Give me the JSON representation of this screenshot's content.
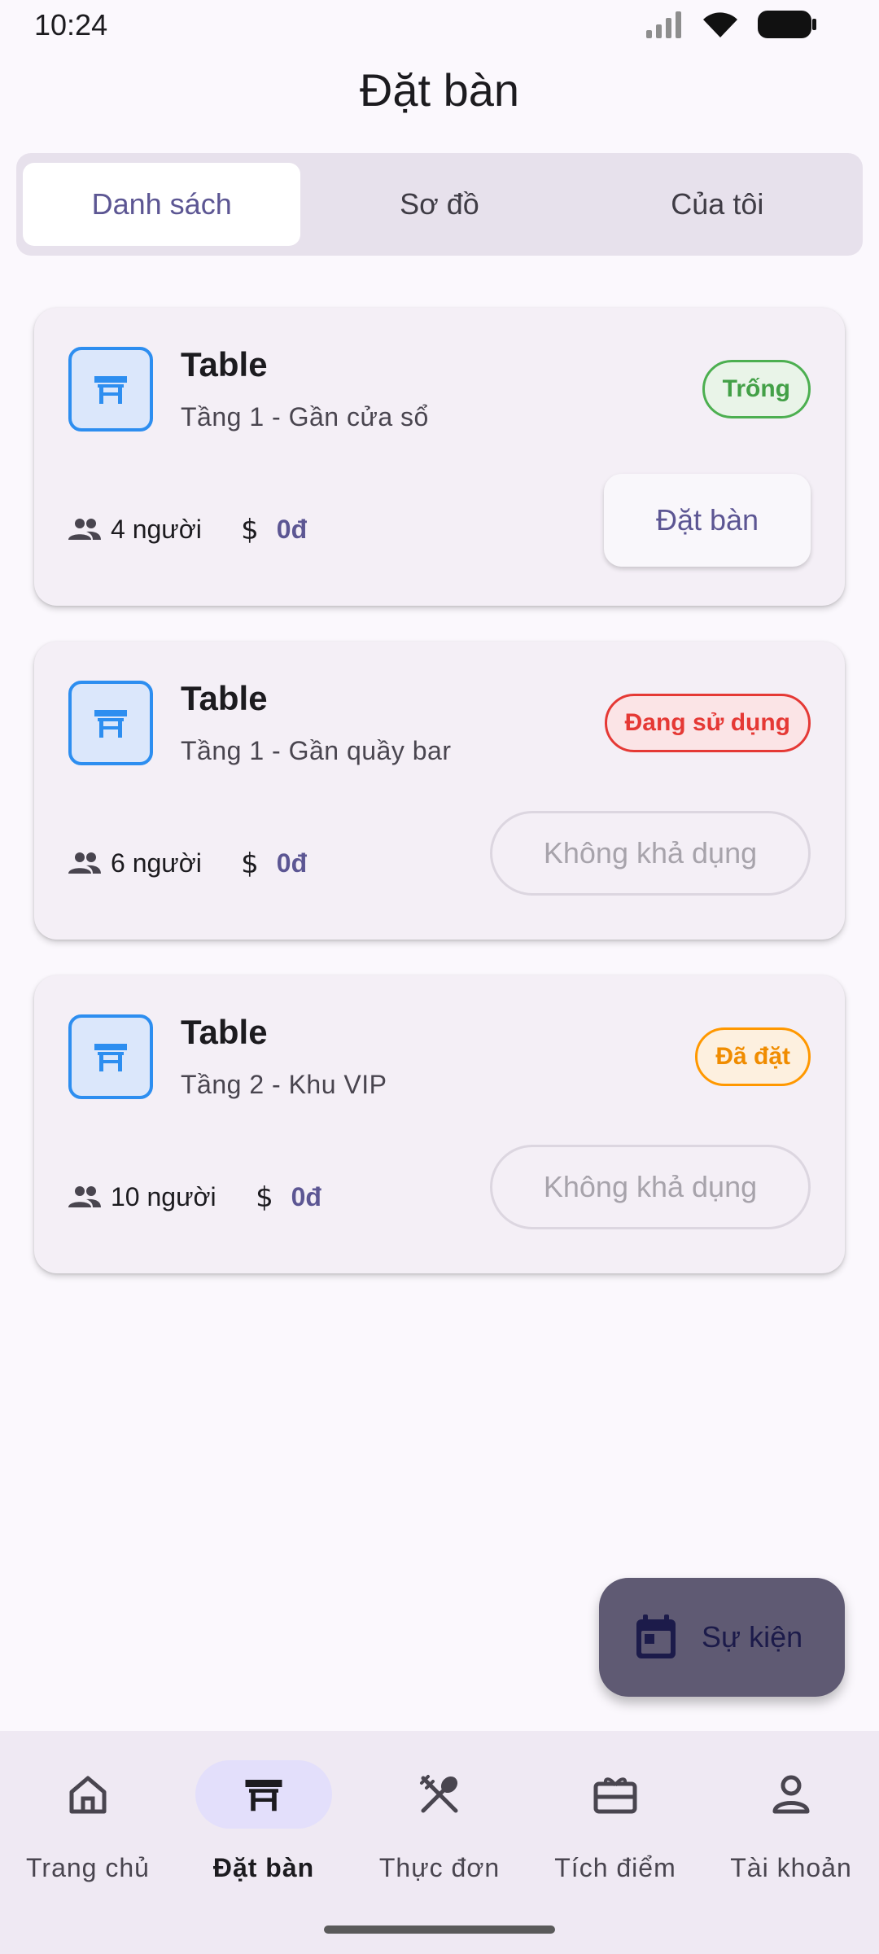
{
  "status_bar": {
    "time": "10:24"
  },
  "header": {
    "title": "Đặt bàn"
  },
  "tabs": [
    {
      "label": "Danh sách",
      "active": true
    },
    {
      "label": "Sơ đồ",
      "active": false
    },
    {
      "label": "Của tôi",
      "active": false
    }
  ],
  "tables": [
    {
      "name": "Table",
      "location": "Tầng 1 - Gần cửa sổ",
      "status": "Trống",
      "status_color": "#43a047",
      "capacity": "4 người",
      "price": "0đ",
      "action": "Đặt bàn",
      "available": true
    },
    {
      "name": "Table",
      "location": "Tầng 1 - Gần quầy bar",
      "status": "Đang sử dụng",
      "status_color": "#e53935",
      "capacity": "6 người",
      "price": "0đ",
      "action": "Không khả dụng",
      "available": false
    },
    {
      "name": "Table",
      "location": "Tầng 2 - Khu VIP",
      "status": "Đã đặt",
      "status_color": "#f08c00",
      "capacity": "10 người",
      "price": "0đ",
      "action": "Không khả dụng",
      "available": false
    }
  ],
  "fab": {
    "label": "Sự kiện",
    "icon": "calendar-icon"
  },
  "bottom_nav": [
    {
      "label": "Trang chủ",
      "icon": "home-icon",
      "active": false
    },
    {
      "label": "Đặt bàn",
      "icon": "table-icon",
      "active": true
    },
    {
      "label": "Thực đơn",
      "icon": "utensils-icon",
      "active": false
    },
    {
      "label": "Tích điểm",
      "icon": "gift-card-icon",
      "active": false
    },
    {
      "label": "Tài khoản",
      "icon": "person-icon",
      "active": false
    }
  ],
  "colors": {
    "accent": "#5c5693",
    "table_icon": "#2d8ef0",
    "background": "#fbf8fd"
  }
}
